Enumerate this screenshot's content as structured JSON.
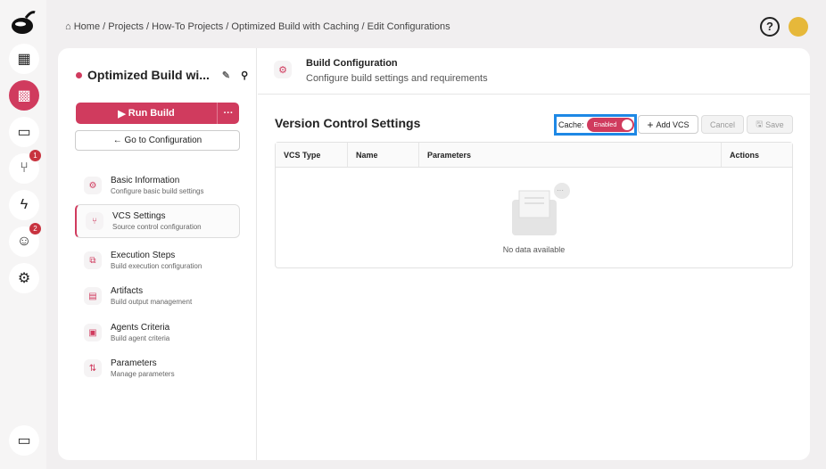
{
  "breadcrumb": {
    "items": [
      "Home",
      "Projects",
      "How-To Projects",
      "Optimized Build with Caching",
      "Edit Configurations"
    ]
  },
  "rail": {
    "badges": {
      "vcs": "1",
      "users": "2"
    }
  },
  "project": {
    "title": "Optimized Build wi...",
    "run_label": "Run Build",
    "more_label": "···",
    "goto_label": "← Go to Configuration"
  },
  "nav": [
    {
      "title": "Basic Information",
      "sub": "Configure basic build settings",
      "icon": "⚙"
    },
    {
      "title": "VCS Settings",
      "sub": "Source control configuration",
      "icon": "⑂"
    },
    {
      "title": "Execution Steps",
      "sub": "Build execution configuration",
      "icon": "⧉"
    },
    {
      "title": "Artifacts",
      "sub": "Build output management",
      "icon": "▤"
    },
    {
      "title": "Agents Criteria",
      "sub": "Build agent criteria",
      "icon": "▣"
    },
    {
      "title": "Parameters",
      "sub": "Manage parameters",
      "icon": "⇅"
    }
  ],
  "header": {
    "title": "Build Configuration",
    "subtitle": "Configure build settings and requirements"
  },
  "section": {
    "title": "Version Control Settings",
    "cache_label": "Cache:",
    "cache_state": "Enabled",
    "add_label": "Add VCS",
    "cancel_label": "Cancel",
    "save_label": "Save"
  },
  "table": {
    "columns": [
      "VCS Type",
      "Name",
      "Parameters",
      "Actions"
    ],
    "empty": "No data available"
  },
  "colors": {
    "accent": "#d03b5e",
    "highlight": "#1e88e5"
  }
}
